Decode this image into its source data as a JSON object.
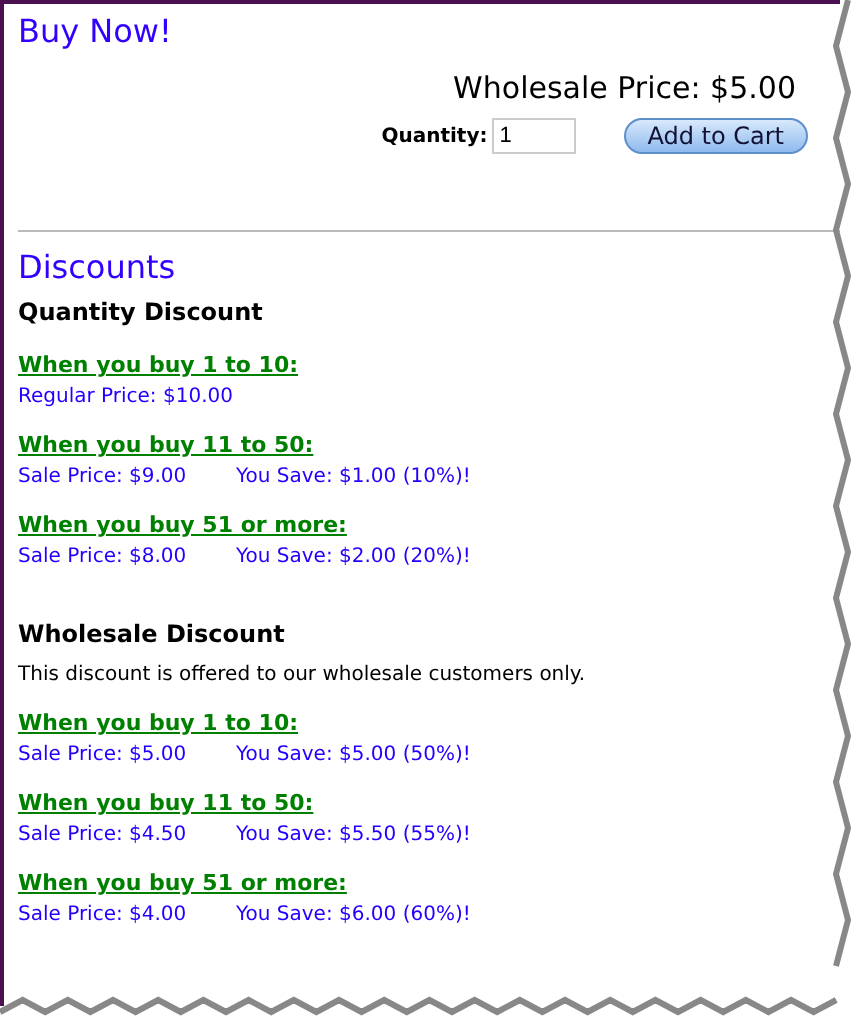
{
  "buy_now": {
    "title": "Buy Now!",
    "price": "Wholesale Price: $5.00",
    "quantity_label": "Quantity:",
    "quantity_value": "1",
    "button": "Add to Cart"
  },
  "discounts": {
    "title": "Discounts",
    "groups": [
      {
        "title": "Quantity Discount",
        "tiers": [
          {
            "heading": "When you buy 1 to 10:",
            "price": "Regular Price: $10.00"
          },
          {
            "heading": "When you buy 11 to 50:",
            "price": "Sale Price: $9.00",
            "saving": "You Save: $1.00 (10%)!"
          },
          {
            "heading": "When you buy 51 or more:",
            "price": "Sale Price: $8.00",
            "saving": "You Save: $2.00 (20%)!"
          }
        ]
      },
      {
        "title": "Wholesale Discount",
        "note": "This discount is offered to our wholesale customers only.",
        "tiers": [
          {
            "heading": "When you buy 1 to 10:",
            "price": "Sale Price: $5.00",
            "saving": "You Save: $5.00 (50%)!"
          },
          {
            "heading": "When you buy 11 to 50:",
            "price": "Sale Price: $4.50",
            "saving": "You Save: $5.50 (55%)!"
          },
          {
            "heading": "When you buy 51 or more:",
            "price": "Sale Price: $4.00",
            "saving": "You Save: $6.00 (60%)!"
          }
        ]
      }
    ]
  }
}
